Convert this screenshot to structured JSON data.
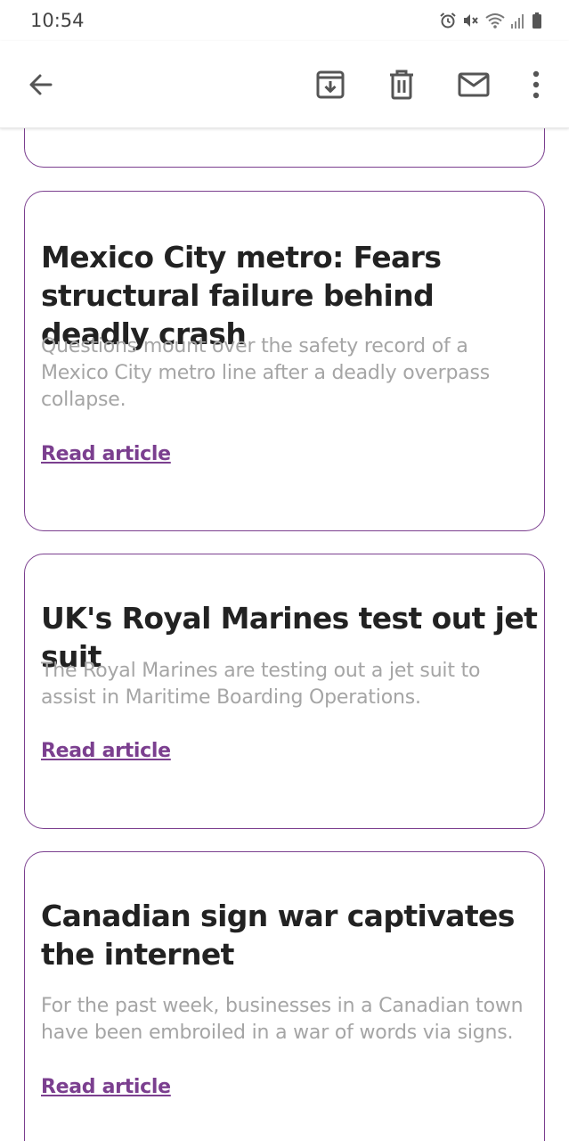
{
  "status_bar": {
    "time": "10:54",
    "icons": [
      "alarm-icon",
      "mute-icon",
      "wifi-icon",
      "signal-icon",
      "battery-icon"
    ]
  },
  "toolbar": {
    "back_icon": "arrow-back-icon",
    "actions": [
      "archive-icon",
      "delete-icon",
      "mail-icon",
      "more-vert-icon"
    ]
  },
  "articles": [
    {
      "title": "Mexico City metro: Fears structural failure behind deadly crash",
      "description": "Questions mount over the safety record of a Mexico City metro line after a deadly overpass collapse.",
      "link": "Read article"
    },
    {
      "title": "UK's Royal Marines test out jet suit",
      "description": "The Royal Marines are testing out a jet suit to assist in Maritime Boarding Operations.",
      "link": "Read article"
    },
    {
      "title": "Canadian sign war captivates the internet",
      "description": "For the past week, businesses in a Canadian town have been embroiled in a war of words via signs.",
      "link": "Read article"
    }
  ],
  "colors": {
    "accent": "#7b3f8f",
    "title": "#222222",
    "description": "#a5a5a5",
    "icon": "#555555"
  }
}
